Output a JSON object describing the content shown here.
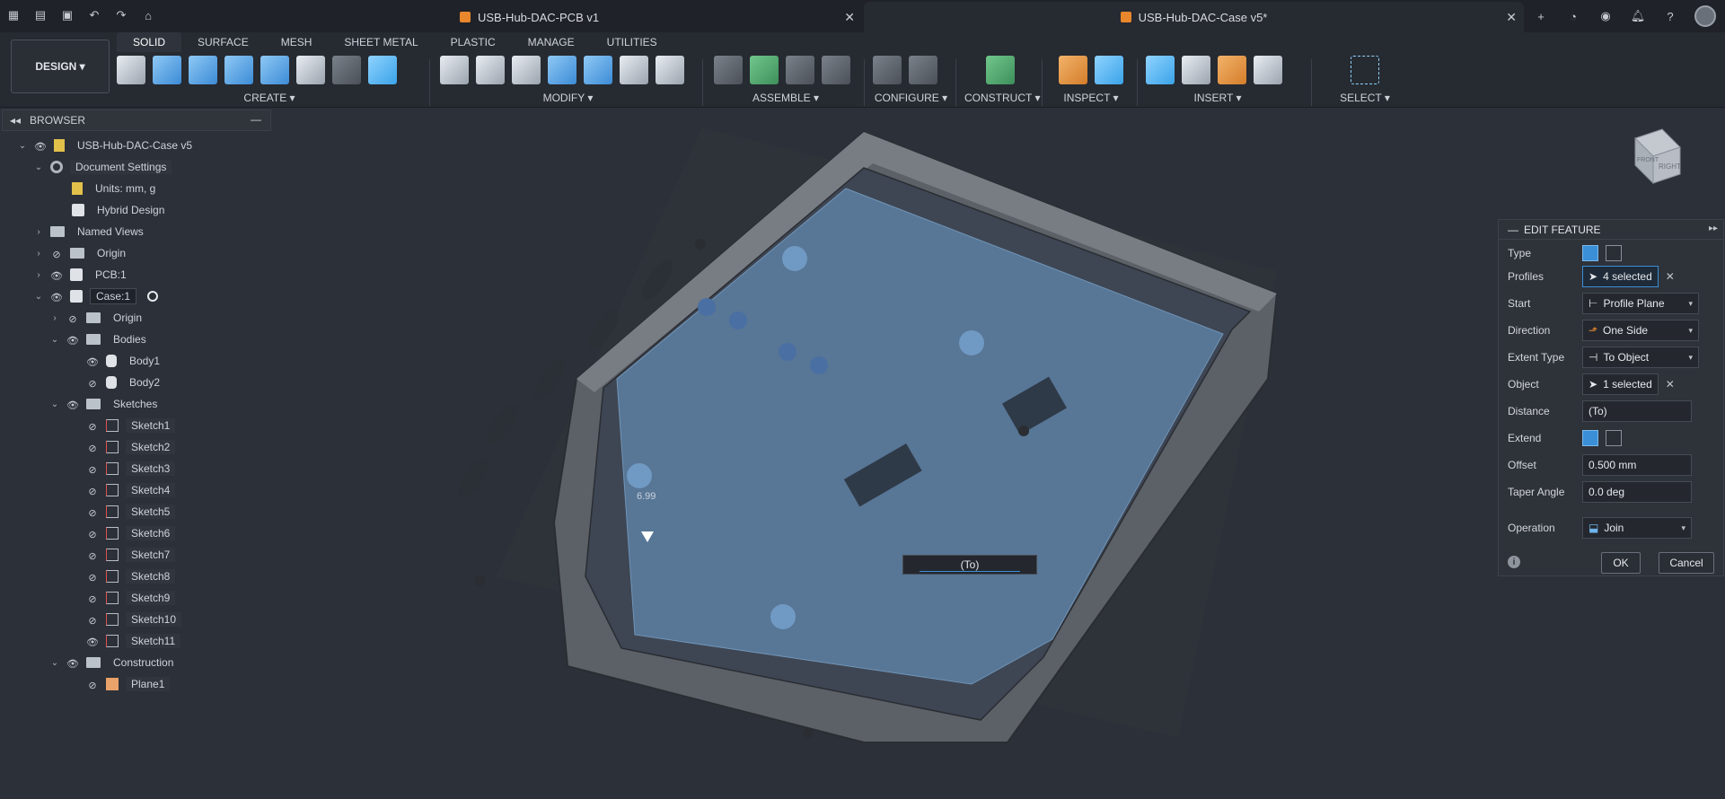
{
  "titlebar": {
    "tabs": [
      {
        "label": "USB-Hub-DAC-PCB v1",
        "active": false
      },
      {
        "label": "USB-Hub-DAC-Case v5*",
        "active": true
      }
    ]
  },
  "toolbar": {
    "workspace": "DESIGN",
    "tabs": [
      "SOLID",
      "SURFACE",
      "MESH",
      "SHEET METAL",
      "PLASTIC",
      "MANAGE",
      "UTILITIES"
    ],
    "groups": [
      "CREATE",
      "MODIFY",
      "ASSEMBLE",
      "CONFIGURE",
      "CONSTRUCT",
      "INSPECT",
      "INSERT",
      "SELECT"
    ]
  },
  "browser": {
    "title": "BROWSER",
    "items": [
      {
        "label": "USB-Hub-DAC-Case v5"
      },
      {
        "label": "Document Settings"
      },
      {
        "label": "Units: mm, g"
      },
      {
        "label": "Hybrid Design"
      },
      {
        "label": "Named Views"
      },
      {
        "label": "Origin"
      },
      {
        "label": "PCB:1"
      },
      {
        "label": "Case:1"
      },
      {
        "label": "Origin"
      },
      {
        "label": "Bodies"
      },
      {
        "label": "Body1"
      },
      {
        "label": "Body2"
      },
      {
        "label": "Sketches"
      },
      {
        "label": "Sketch1"
      },
      {
        "label": "Sketch2"
      },
      {
        "label": "Sketch3"
      },
      {
        "label": "Sketch4"
      },
      {
        "label": "Sketch5"
      },
      {
        "label": "Sketch6"
      },
      {
        "label": "Sketch7"
      },
      {
        "label": "Sketch8"
      },
      {
        "label": "Sketch9"
      },
      {
        "label": "Sketch10"
      },
      {
        "label": "Sketch11"
      },
      {
        "label": "Construction"
      },
      {
        "label": "Plane1"
      }
    ]
  },
  "viewport": {
    "dimension_label": "6.99",
    "input_value": "(To)",
    "viewcube": {
      "front": "FRONT",
      "right": "RIGHT"
    }
  },
  "edit_feature": {
    "title": "EDIT FEATURE",
    "fields": {
      "type_label": "Type",
      "profiles_label": "Profiles",
      "profiles_value": "4 selected",
      "start_label": "Start",
      "start_value": "Profile Plane",
      "direction_label": "Direction",
      "direction_value": "One Side",
      "extent_label": "Extent Type",
      "extent_value": "To Object",
      "object_label": "Object",
      "object_value": "1 selected",
      "distance_label": "Distance",
      "distance_value": "(To)",
      "extend_label": "Extend",
      "offset_label": "Offset",
      "offset_value": "0.500 mm",
      "taper_label": "Taper Angle",
      "taper_value": "0.0 deg",
      "operation_label": "Operation",
      "operation_value": "Join"
    },
    "ok_label": "OK",
    "cancel_label": "Cancel"
  },
  "colors": {
    "accent": "#3b8fd6",
    "background": "#2c3038",
    "panel": "#262a31"
  }
}
